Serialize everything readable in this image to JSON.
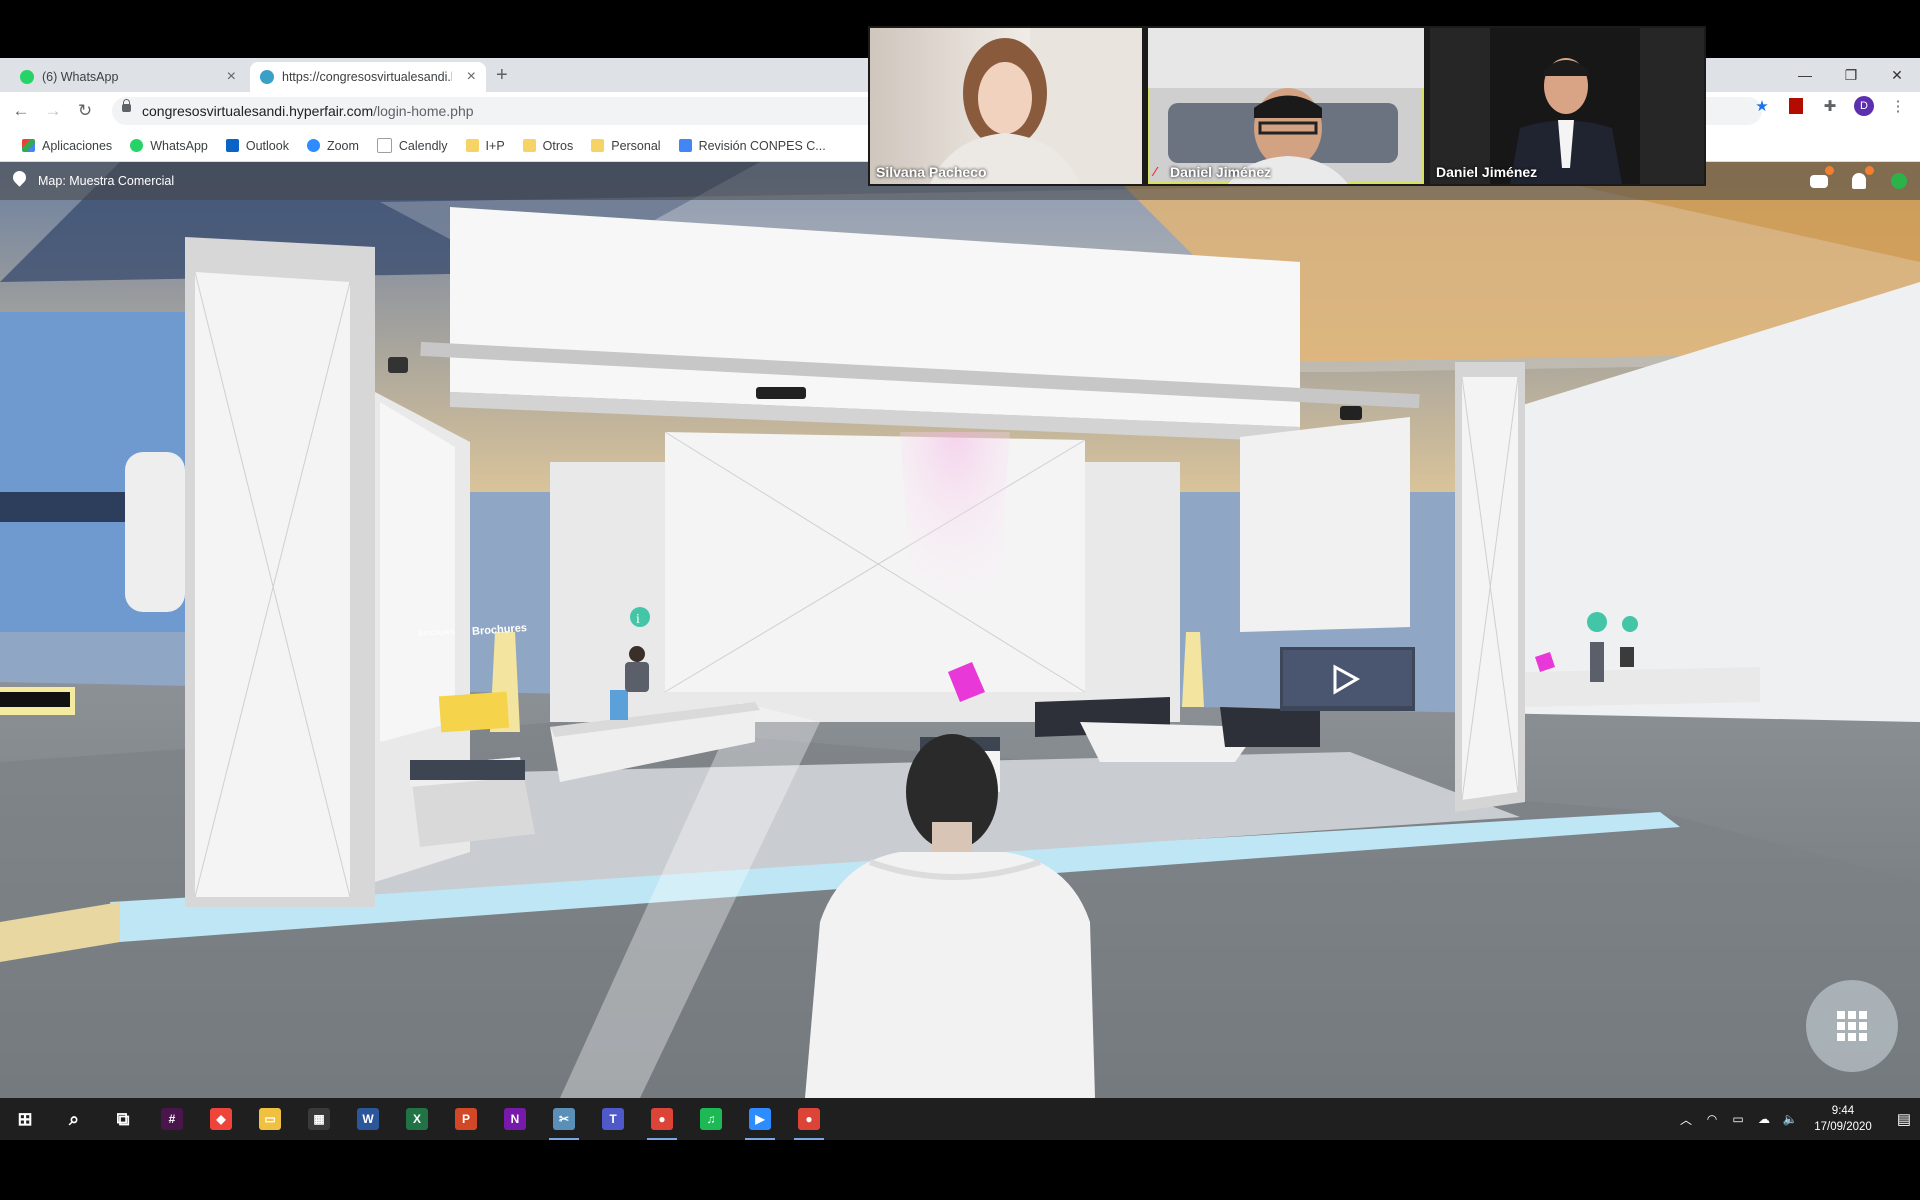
{
  "browser": {
    "tabs": [
      {
        "label": "(6) WhatsApp",
        "active": false,
        "icon": "whatsapp-icon",
        "color": "#25d366"
      },
      {
        "label": "https://congresosvirtualesandi.h",
        "active": true,
        "icon": "hyperfair-icon",
        "color": "#3aa0c8"
      }
    ],
    "new_tab": "+",
    "url_host": "congresosvirtualesandi.hyperfair.com",
    "url_path": "/login-home.php",
    "profile_initial": "D",
    "bookmarks": [
      {
        "label": "Aplicaciones",
        "icon": "apps-grid-icon",
        "color": "#e94235"
      },
      {
        "label": "WhatsApp",
        "icon": "whatsapp-icon",
        "color": "#25d366"
      },
      {
        "label": "Outlook",
        "icon": "outlook-icon",
        "color": "#0a64c8"
      },
      {
        "label": "Zoom",
        "icon": "zoom-icon",
        "color": "#2d8cff"
      },
      {
        "label": "Calendly",
        "icon": "calendly-icon",
        "color": "#9aa0a6"
      },
      {
        "label": "I+P",
        "icon": "folder-icon",
        "color": "#f6d365"
      },
      {
        "label": "Otros",
        "icon": "folder-icon",
        "color": "#f6d365"
      },
      {
        "label": "Personal",
        "icon": "folder-icon",
        "color": "#f6d365"
      },
      {
        "label": "Revisión CONPES C...",
        "icon": "docs-icon",
        "color": "#4285f4"
      }
    ]
  },
  "scene": {
    "map_label": "Map: Muestra Comercial",
    "brochures_label": "Brochures",
    "brochures_label_small": "Brochures"
  },
  "video": {
    "participants": [
      {
        "name": "Silvana Pacheco",
        "muted": false,
        "speaking": false
      },
      {
        "name": "Daniel Jiménez",
        "muted": true,
        "speaking": true
      },
      {
        "name": "Daniel Jiménez",
        "muted": false,
        "speaking": false
      }
    ]
  },
  "taskbar": {
    "apps": [
      {
        "name": "start-button",
        "glyph": "⊞",
        "color": "transparent"
      },
      {
        "name": "search",
        "glyph": "⌕",
        "color": "transparent"
      },
      {
        "name": "task-view",
        "glyph": "⧉",
        "color": "transparent"
      },
      {
        "name": "slack",
        "glyph": "#",
        "color": "#4a154b"
      },
      {
        "name": "anydesk",
        "glyph": "◆",
        "color": "#ef443b"
      },
      {
        "name": "file-explorer",
        "glyph": "▭",
        "color": "#f0c040"
      },
      {
        "name": "calculator",
        "glyph": "▦",
        "color": "#3a3a3a"
      },
      {
        "name": "word",
        "glyph": "W",
        "color": "#2b579a"
      },
      {
        "name": "excel",
        "glyph": "X",
        "color": "#217346"
      },
      {
        "name": "powerpoint",
        "glyph": "P",
        "color": "#d24726"
      },
      {
        "name": "onenote",
        "glyph": "N",
        "color": "#7719aa"
      },
      {
        "name": "snip",
        "glyph": "✂",
        "color": "#5a8fb8"
      },
      {
        "name": "teams",
        "glyph": "T",
        "color": "#5059c9"
      },
      {
        "name": "chrome",
        "glyph": "●",
        "color": "#db4437"
      },
      {
        "name": "spotify",
        "glyph": "♫",
        "color": "#1db954"
      },
      {
        "name": "zoom",
        "glyph": "▶",
        "color": "#2d8cff"
      },
      {
        "name": "chrome-profile",
        "glyph": "●",
        "color": "#db4437"
      }
    ],
    "time": "9:44",
    "date": "17/09/2020"
  },
  "colors": {
    "accent": "#1a73e8",
    "status_online": "#2bb34a",
    "speaker_outline": "#d8e060"
  }
}
